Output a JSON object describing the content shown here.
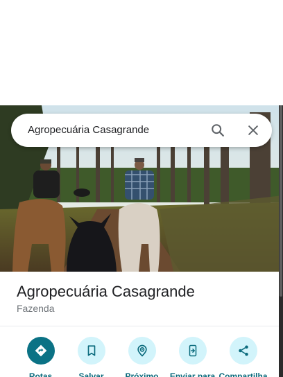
{
  "search": {
    "query": "Agropecuária Casagrande"
  },
  "place": {
    "name": "Agropecuária Casagrande",
    "category": "Fazenda"
  },
  "actions": [
    {
      "label": "Rotas",
      "icon": "directions-icon"
    },
    {
      "label": "Salvar",
      "icon": "bookmark-icon"
    },
    {
      "label": "Próximo",
      "icon": "nearby-icon"
    },
    {
      "label": "Enviar para",
      "icon": "send-to-phone-icon"
    },
    {
      "label": "Compartilha",
      "icon": "share-icon"
    }
  ],
  "colors": {
    "accent": "#0b7285",
    "accent_light": "#d2f4fb",
    "label": "#0b6b7d"
  }
}
